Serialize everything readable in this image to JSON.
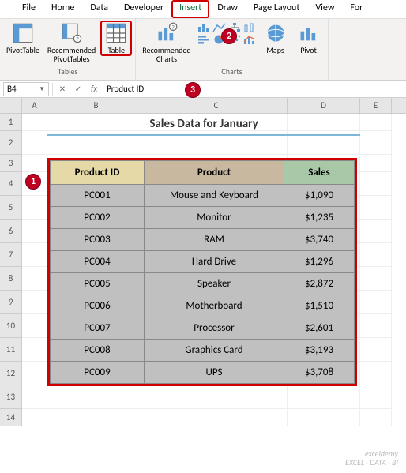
{
  "tabs": {
    "file": "File",
    "home": "Home",
    "data": "Data",
    "developer": "Developer",
    "insert": "Insert",
    "draw": "Draw",
    "page_layout": "Page Layout",
    "view": "View",
    "for": "For"
  },
  "ribbon": {
    "tables_group": "Tables",
    "charts_group": "Charts",
    "pivottable": "PivotTable",
    "recommended_pivots": "Recommended\nPivotTables",
    "table": "Table",
    "recommended_charts": "Recommended\nCharts",
    "maps": "Maps",
    "pivotc": "Pivot"
  },
  "namebox": "B4",
  "formula_value": "Product ID",
  "cancel": "✕",
  "enter": "✓",
  "cols": [
    "A",
    "B",
    "C",
    "D",
    "E"
  ],
  "rows": [
    "1",
    "2",
    "3",
    "4",
    "5",
    "6",
    "7",
    "8",
    "9",
    "10",
    "11",
    "12",
    "13",
    "14"
  ],
  "title": "Sales Data for January",
  "headers": {
    "prodid": "Product ID",
    "prod": "Product",
    "sales": "Sales"
  },
  "data": [
    {
      "id": "PC001",
      "prod": "Mouse and Keyboard",
      "sales": "$1,090"
    },
    {
      "id": "PC002",
      "prod": "Monitor",
      "sales": "$1,235"
    },
    {
      "id": "PC003",
      "prod": "RAM",
      "sales": "$3,740"
    },
    {
      "id": "PC004",
      "prod": "Hard Drive",
      "sales": "$1,296"
    },
    {
      "id": "PC005",
      "prod": "Speaker",
      "sales": "$2,872"
    },
    {
      "id": "PC006",
      "prod": "Motherboard",
      "sales": "$1,510"
    },
    {
      "id": "PC007",
      "prod": "Processor",
      "sales": "$2,601"
    },
    {
      "id": "PC008",
      "prod": "Graphics Card",
      "sales": "$3,193"
    },
    {
      "id": "PC009",
      "prod": "UPS",
      "sales": "$3,708"
    }
  ],
  "callouts": {
    "c1": "1",
    "c2": "2",
    "c3": "3"
  },
  "watermark": {
    "l1": "exceldemy",
    "l2": "EXCEL · DATA · BI"
  },
  "chart_data": {
    "type": "table",
    "title": "Sales Data for January",
    "columns": [
      "Product ID",
      "Product",
      "Sales"
    ],
    "rows": [
      [
        "PC001",
        "Mouse and Keyboard",
        1090
      ],
      [
        "PC002",
        "Monitor",
        1235
      ],
      [
        "PC003",
        "RAM",
        3740
      ],
      [
        "PC004",
        "Hard Drive",
        1296
      ],
      [
        "PC005",
        "Speaker",
        2872
      ],
      [
        "PC006",
        "Motherboard",
        1510
      ],
      [
        "PC007",
        "Processor",
        2601
      ],
      [
        "PC008",
        "Graphics Card",
        3193
      ],
      [
        "PC009",
        "UPS",
        3708
      ]
    ]
  }
}
